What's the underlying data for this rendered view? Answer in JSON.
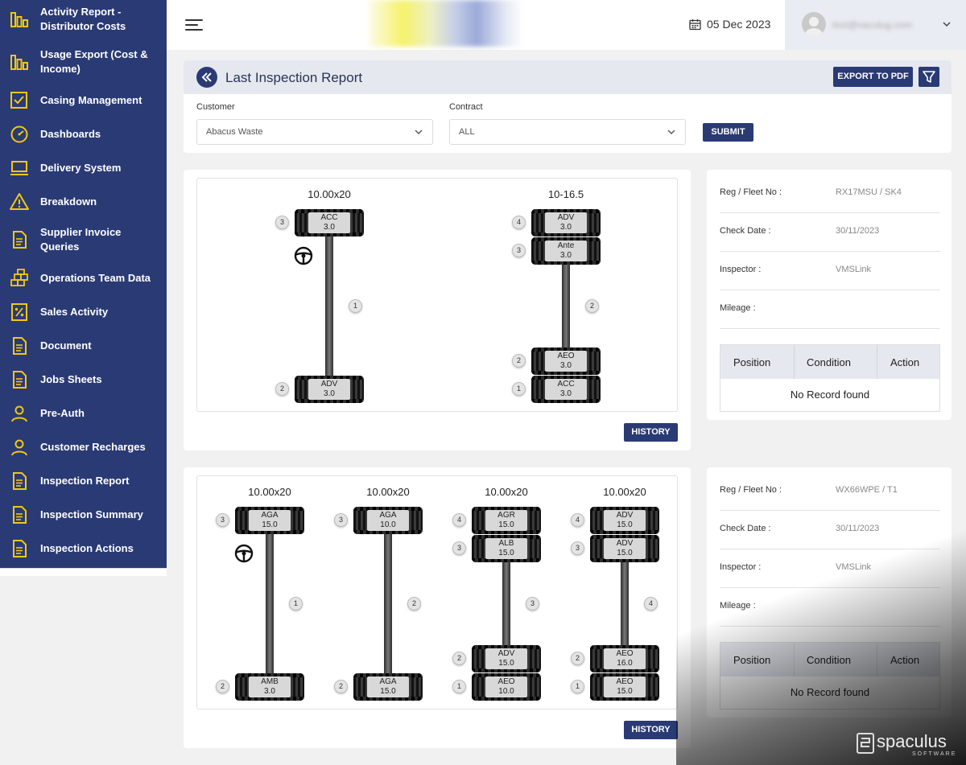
{
  "sidebar": {
    "items": [
      {
        "label": "Activity Report - Distributor Costs",
        "icon": "bar-chart-icon"
      },
      {
        "label": "Usage Export (Cost & Income)",
        "icon": "bar-chart-icon"
      },
      {
        "label": "Casing Management",
        "icon": "checkbox-icon"
      },
      {
        "label": "Dashboards",
        "icon": "gauge-icon"
      },
      {
        "label": "Delivery System",
        "icon": "laptop-icon"
      },
      {
        "label": "Breakdown",
        "icon": "warning-icon"
      },
      {
        "label": "Supplier Invoice Queries",
        "icon": "document-icon"
      },
      {
        "label": "Operations Team Data",
        "icon": "stack-icon"
      },
      {
        "label": "Sales Activity",
        "icon": "percent-icon"
      },
      {
        "label": "Document",
        "icon": "document-icon"
      },
      {
        "label": "Jobs Sheets",
        "icon": "document-icon"
      },
      {
        "label": "Pre-Auth",
        "icon": "user-icon"
      },
      {
        "label": "Customer Recharges",
        "icon": "user-icon"
      },
      {
        "label": "Inspection Report",
        "icon": "document-icon"
      },
      {
        "label": "Inspection Summary",
        "icon": "document-icon"
      },
      {
        "label": "Inspection Actions",
        "icon": "document-icon"
      }
    ]
  },
  "header": {
    "date": "05 Dec 2023",
    "user_email": "test@vaculug.com"
  },
  "report": {
    "title": "Last Inspection Report",
    "export_label": "EXPORT TO PDF",
    "customer_label": "Customer",
    "customer_value": "Abacus Waste",
    "contract_label": "Contract",
    "contract_value": "ALL",
    "submit_label": "SUBMIT"
  },
  "vehicles": [
    {
      "history_label": "HISTORY",
      "axles": [
        {
          "size": "10.00x20",
          "num": "1",
          "steer": true,
          "top": [
            {
              "pos": "3",
              "code": "ACC",
              "val": "3.0"
            }
          ],
          "bottom": [
            {
              "pos": "2",
              "code": "ADV",
              "val": "3.0"
            }
          ]
        },
        {
          "size": "10-16.5",
          "num": "2",
          "steer": false,
          "top": [
            {
              "pos": "4",
              "code": "ADV",
              "val": "3.0"
            },
            {
              "pos": "3",
              "code": "Ante",
              "val": "3.0"
            }
          ],
          "bottom": [
            {
              "pos": "2",
              "code": "AEO",
              "val": "3.0"
            },
            {
              "pos": "1",
              "code": "ACC",
              "val": "3.0"
            }
          ]
        }
      ],
      "info": {
        "reg_label": "Reg / Fleet No :",
        "reg_value": "RX17MSU / SK4",
        "check_label": "Check Date :",
        "check_value": "30/11/2023",
        "inspector_label": "Inspector :",
        "inspector_value": "VMSLink",
        "mileage_label": "Mileage :",
        "mileage_value": "",
        "col_position": "Position",
        "col_condition": "Condition",
        "col_action": "Action",
        "empty": "No Record found"
      }
    },
    {
      "history_label": "HISTORY",
      "axles": [
        {
          "size": "10.00x20",
          "num": "1",
          "steer": true,
          "top": [
            {
              "pos": "3",
              "code": "AGA",
              "val": "15.0"
            }
          ],
          "bottom": [
            {
              "pos": "2",
              "code": "AMB",
              "val": "3.0"
            }
          ]
        },
        {
          "size": "10.00x20",
          "num": "2",
          "steer": false,
          "top": [
            {
              "pos": "3",
              "code": "AGA",
              "val": "10.0"
            }
          ],
          "bottom": [
            {
              "pos": "2",
              "code": "AGA",
              "val": "15.0"
            }
          ]
        },
        {
          "size": "10.00x20",
          "num": "3",
          "steer": false,
          "top": [
            {
              "pos": "4",
              "code": "AGR",
              "val": "15.0"
            },
            {
              "pos": "3",
              "code": "ALB",
              "val": "15.0"
            }
          ],
          "bottom": [
            {
              "pos": "2",
              "code": "ADV",
              "val": "15.0"
            },
            {
              "pos": "1",
              "code": "AEO",
              "val": "10.0"
            }
          ]
        },
        {
          "size": "10.00x20",
          "num": "4",
          "steer": false,
          "top": [
            {
              "pos": "4",
              "code": "ADV",
              "val": "15.0"
            },
            {
              "pos": "3",
              "code": "ADV",
              "val": "15.0"
            }
          ],
          "bottom": [
            {
              "pos": "2",
              "code": "AEO",
              "val": "16.0"
            },
            {
              "pos": "1",
              "code": "AEO",
              "val": "15.0"
            }
          ]
        }
      ],
      "info": {
        "reg_label": "Reg / Fleet No :",
        "reg_value": "WX66WPE / T1",
        "check_label": "Check Date :",
        "check_value": "30/11/2023",
        "inspector_label": "Inspector :",
        "inspector_value": "VMSLink",
        "mileage_label": "Mileage :",
        "mileage_value": "",
        "col_position": "Position",
        "col_condition": "Condition",
        "col_action": "Action",
        "empty": "No Record found"
      }
    }
  ],
  "watermark": {
    "brand": "spaculus",
    "tagline": "SOFTWARE"
  },
  "colors": {
    "primary": "#2a3a75",
    "accent": "#f2c811",
    "panel_head": "#e5e8ef"
  }
}
